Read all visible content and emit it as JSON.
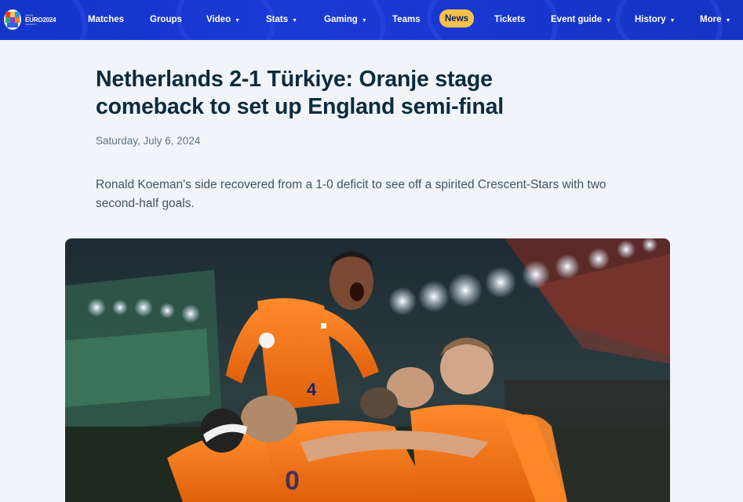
{
  "nav": {
    "logo": {
      "line1": "UEFA",
      "line2": "EURO2024",
      "line3": "GERMANY"
    },
    "items": [
      {
        "label": "Matches",
        "dropdown": false
      },
      {
        "label": "Groups",
        "dropdown": false
      },
      {
        "label": "Video",
        "dropdown": true
      },
      {
        "label": "Stats",
        "dropdown": true
      },
      {
        "label": "Gaming",
        "dropdown": true
      },
      {
        "label": "Teams",
        "dropdown": false
      },
      {
        "label": "News",
        "dropdown": false,
        "active": true
      },
      {
        "label": "Tickets",
        "dropdown": false
      },
      {
        "label": "Event guide",
        "dropdown": true
      },
      {
        "label": "History",
        "dropdown": true
      },
      {
        "label": "More",
        "dropdown": true
      }
    ],
    "chevron_icon": "chevron-down-icon",
    "colors": {
      "background": "#1436c9",
      "active_pill": "#f7c14c"
    }
  },
  "article": {
    "headline": "Netherlands 2-1 Türkiye: Oranje stage comeback to set up England semi-final",
    "date": "Saturday, July 6, 2024",
    "standfirst": "Ronald Koeman's side recovered from a 1-0 deficit to see off a spirited Crescent-Stars with two second-half goals.",
    "hero_image": "netherlands-players-celebrating-photo"
  }
}
